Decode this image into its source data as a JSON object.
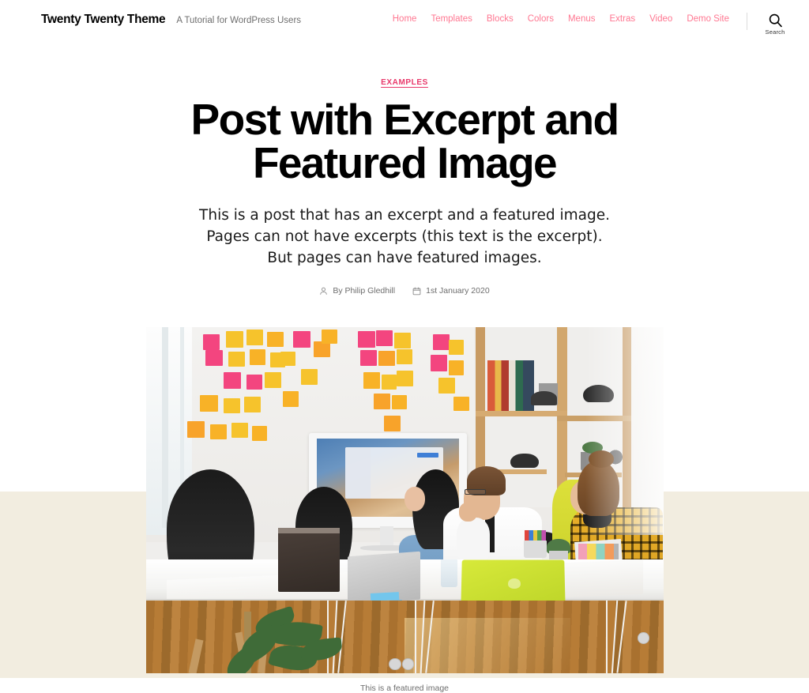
{
  "site": {
    "title": "Twenty Twenty Theme",
    "tagline": "A Tutorial for WordPress Users"
  },
  "nav": {
    "items": [
      {
        "label": "Home"
      },
      {
        "label": "Templates"
      },
      {
        "label": "Blocks"
      },
      {
        "label": "Colors"
      },
      {
        "label": "Menus"
      },
      {
        "label": "Extras"
      },
      {
        "label": "Video"
      },
      {
        "label": "Demo Site"
      }
    ],
    "search": {
      "icon": "search-icon",
      "label": "Search"
    },
    "link_color": "#FF7791"
  },
  "post": {
    "category": "EXAMPLES",
    "category_color": "#E8386A",
    "title": "Post with Excerpt and Featured Image",
    "excerpt_lines": [
      "This is a post that has an excerpt and a featured image.",
      "Pages can not have excerpts (this text is the excerpt).",
      "But pages can have featured images."
    ],
    "meta": {
      "author_icon": "user-icon",
      "author": "By Philip Gledhill",
      "date_icon": "calendar-icon",
      "date": "1st January 2020"
    },
    "featured_image": {
      "alt": "Four colleagues seated at a long white table in a bright meeting room with sticky notes on the wall",
      "caption": "This is a featured image"
    }
  },
  "theme": {
    "background": "#FFFFFF",
    "band_background": "#F2EDE0",
    "text_color": "#000000",
    "muted_text": "#6D6D6D"
  }
}
